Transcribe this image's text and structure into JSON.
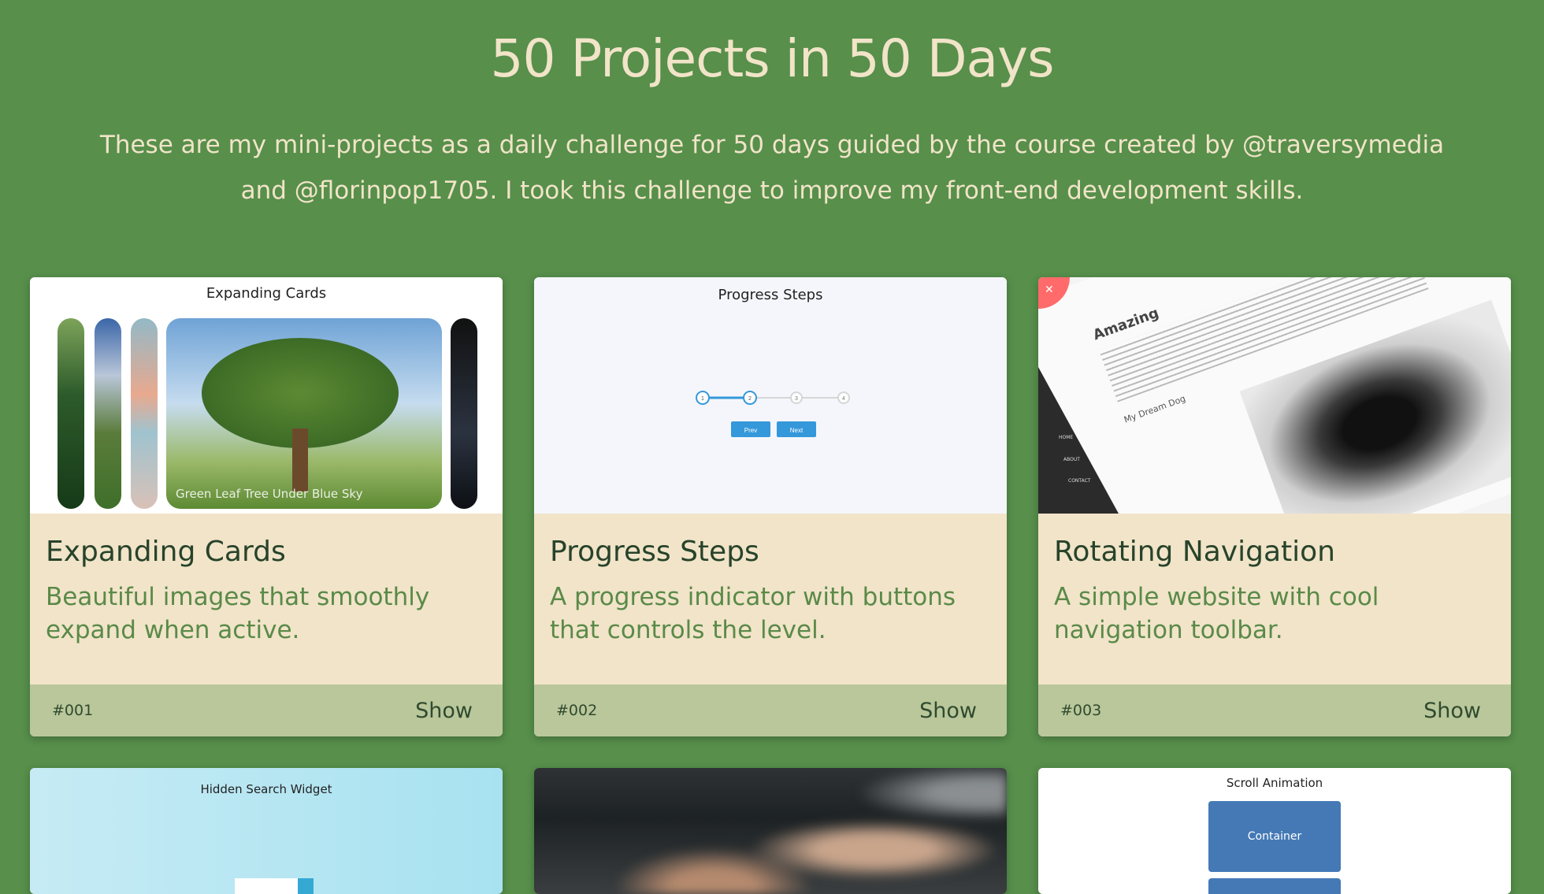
{
  "header": {
    "title": "50 Projects in 50 Days",
    "intro": "These are my mini-projects as a daily challenge for 50 days guided by the course created by @traversymedia and @florinpop1705. I took this challenge to improve my front-end development skills."
  },
  "cards": [
    {
      "title": "Expanding Cards",
      "description": "Beautiful images that smoothly expand when active.",
      "number": "#001",
      "action": "Show",
      "thumb": {
        "title": "Expanding Cards",
        "caption": "Green Leaf Tree Under Blue Sky"
      }
    },
    {
      "title": "Progress Steps",
      "description": "A progress indicator with buttons that controls the level.",
      "number": "#002",
      "action": "Show",
      "thumb": {
        "title": "Progress Steps",
        "steps": [
          "1",
          "2",
          "3",
          "4"
        ],
        "prev": "Prev",
        "next": "Next"
      }
    },
    {
      "title": "Rotating Navigation",
      "description": "A simple website with cool navigation toolbar.",
      "number": "#003",
      "action": "Show",
      "thumb": {
        "title": "Amazing",
        "subtitle": "My Dream Dog",
        "nav": [
          "HOME",
          "ABOUT",
          "CONTACT"
        ]
      }
    },
    {
      "thumb": {
        "title": "Hidden Search Widget"
      }
    },
    {
      "thumb": {}
    },
    {
      "thumb": {
        "title": "Scroll Animation",
        "box": "Container"
      }
    }
  ],
  "colors": {
    "background": "#578f4b",
    "card_body": "#f1e4c9",
    "card_footer": "#bac79b",
    "title_text": "#f1e4c8",
    "card_title": "#27432a",
    "card_desc": "#5a8a48",
    "step_blue": "#3498db"
  }
}
